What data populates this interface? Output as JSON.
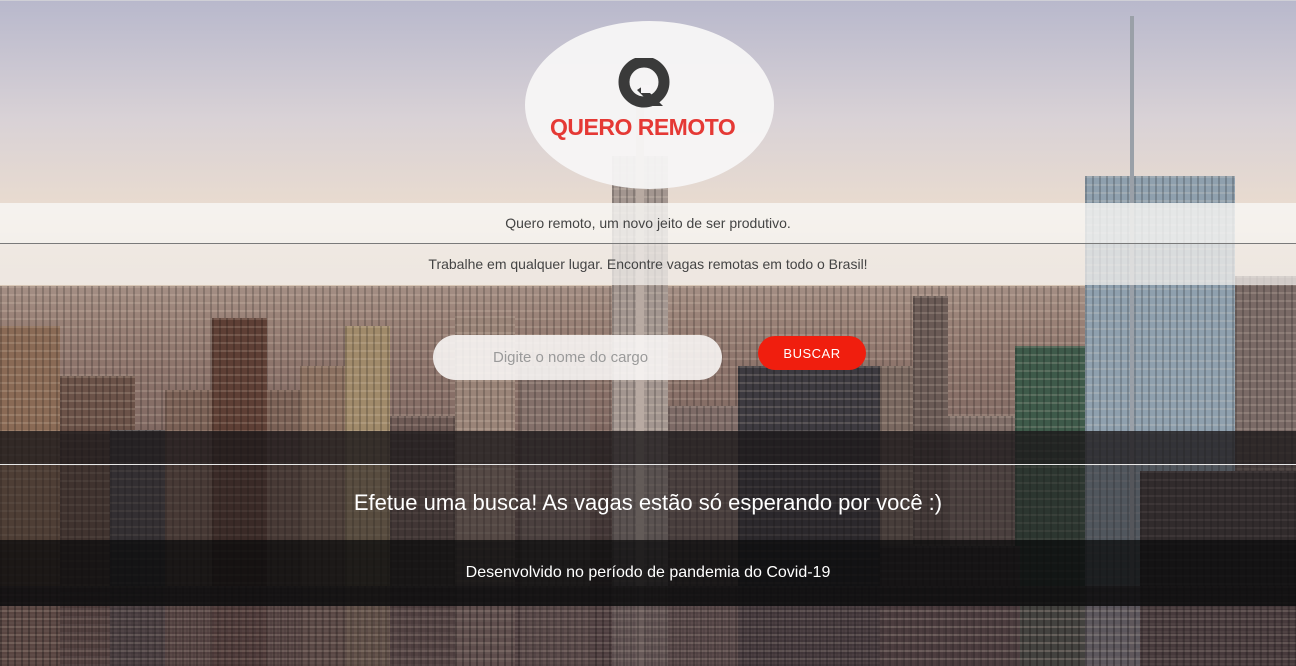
{
  "brand": {
    "name": "QUERO REMOTO",
    "logo_icon": "q-logo-icon",
    "accent_color": "#e53935",
    "mark_color": "#3a3a3a"
  },
  "tagline": "Quero remoto, um novo jeito de ser produtivo.",
  "subtitle": "Trabalhe em qualquer lugar. Encontre vagas remotas em todo o Brasil!",
  "search": {
    "placeholder": "Digite o nome do cargo",
    "button_label": "BUSCAR",
    "button_color": "#f01e0e"
  },
  "message": "Efetue uma busca! As vagas estão só esperando por você :)",
  "footer": {
    "text": "Desenvolvido no período de pandemia do Covid-19"
  }
}
